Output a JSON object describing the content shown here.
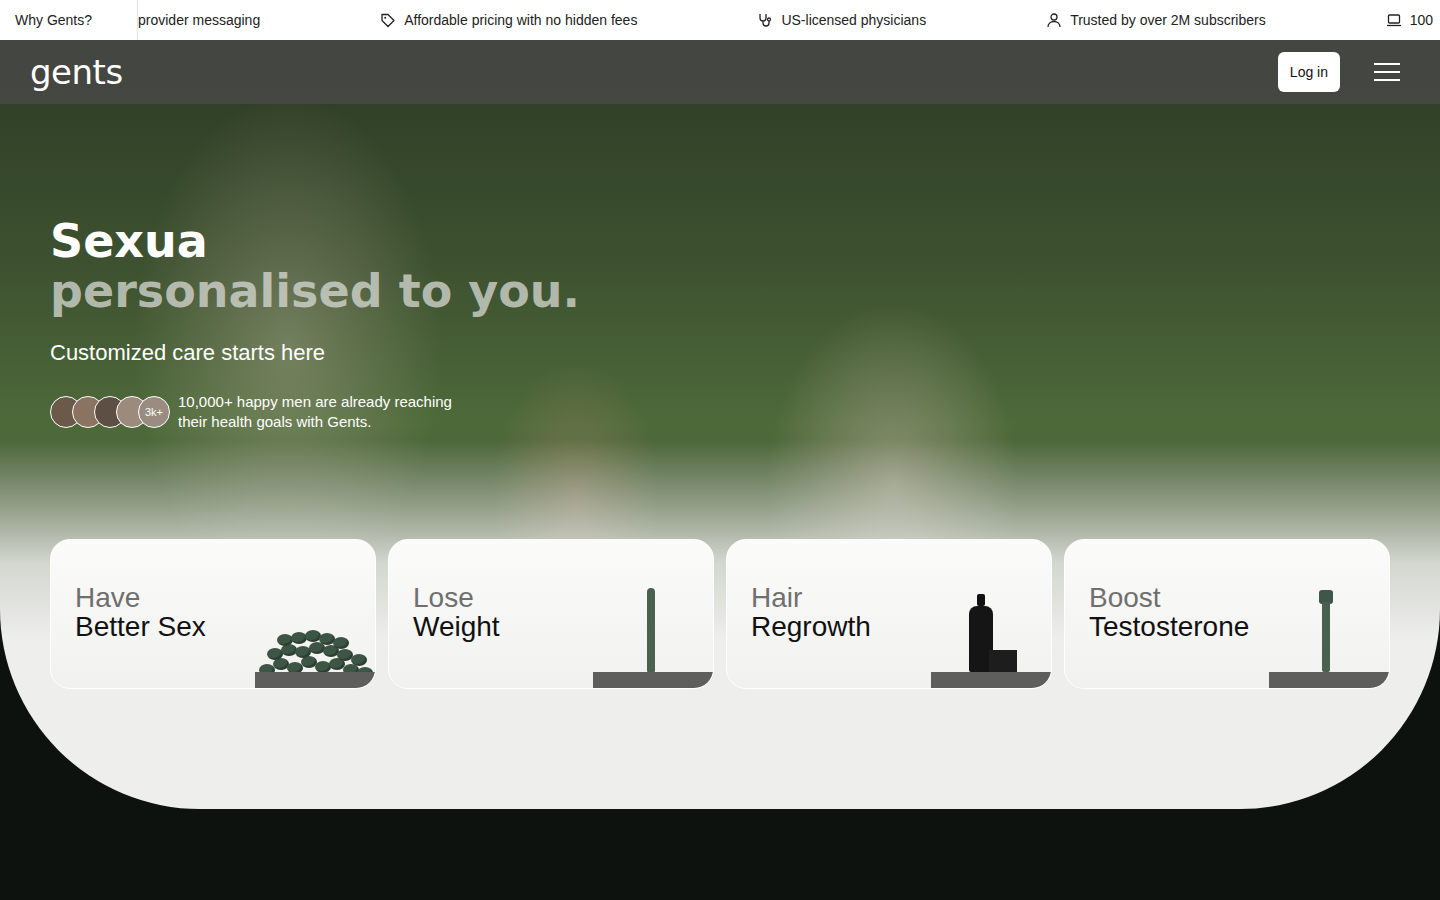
{
  "ticker": {
    "label": "Why Gents?",
    "items": [
      "provider messaging",
      "Affordable pricing with no hidden fees",
      "US-licensed physicians",
      "Trusted by over 2M subscribers",
      "100"
    ]
  },
  "header": {
    "logo": "gents",
    "login": "Log in"
  },
  "hero": {
    "title": "Sexua",
    "subtitle": "personalised to you.",
    "tagline": "Customized care starts here",
    "social": {
      "badge": "3k+",
      "lines": [
        "10,000+ happy men are already reaching",
        "their health goals with Gents."
      ]
    }
  },
  "cards": [
    {
      "verb": "Have",
      "title": "Better Sex",
      "kind": "pills"
    },
    {
      "verb": "Lose",
      "title": "Weight",
      "kind": "pen"
    },
    {
      "verb": "Hair",
      "title": "Regrowth",
      "kind": "spray"
    },
    {
      "verb": "Boost",
      "title": "Testosterone",
      "kind": "injector"
    }
  ]
}
